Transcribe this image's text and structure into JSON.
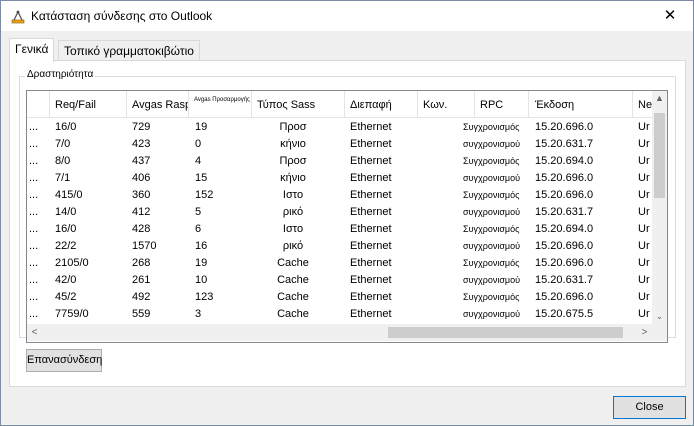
{
  "window": {
    "title": "Κατάσταση σύνδεσης στο Outlook",
    "close_glyph": "✕",
    "icon": "outlook-connection-icon"
  },
  "tabs": [
    {
      "label": "Γενικά"
    },
    {
      "label": "Τοπικό γραμματοκιβώτιο"
    }
  ],
  "group": {
    "label": "Δραστηριότητα"
  },
  "table": {
    "headers": [
      "",
      "Req/Fail",
      "Avgas Rasp",
      "Avgas Προσαρμογής",
      "Τύπος Sass",
      "Διεπαφή",
      "Κων.",
      "RPC",
      "Έκδοση",
      "Ne"
    ],
    "rows": [
      [
        "...",
        "16/0",
        "729",
        "19",
        "Προσ",
        "Ethernet",
        "",
        "Συγχρονισμός",
        "15.20.696.0",
        "Ur"
      ],
      [
        "...",
        "7/0",
        "423",
        "0",
        "κήνιο",
        "Ethernet",
        "",
        "συγχρονισμού",
        "15.20.631.7",
        "Ur"
      ],
      [
        "...",
        "8/0",
        "437",
        "4",
        "Προσ",
        "Ethernet",
        "",
        "Συγχρονισμός",
        "15.20.694.0",
        "Ur"
      ],
      [
        "...",
        "7/1",
        "406",
        "15",
        "κήνιο",
        "Ethernet",
        "",
        "συγχρονισμού",
        "15.20.696.0",
        "Ur"
      ],
      [
        "...",
        "415/0",
        "360",
        "152",
        "Ιστο",
        "Ethernet",
        "",
        "Συγχρονισμός",
        "15.20.696.0",
        "Ur"
      ],
      [
        "...",
        "14/0",
        "412",
        "5",
        "ρικό",
        "Ethernet",
        "",
        "συγχρονισμού",
        "15.20.631.7",
        "Ur"
      ],
      [
        "...",
        "16/0",
        "428",
        "6",
        "Ιστο",
        "Ethernet",
        "",
        "Συγχρονισμός",
        "15.20.694.0",
        "Ur"
      ],
      [
        "...",
        "22/2",
        "1570",
        "16",
        "ρικό",
        "Ethernet",
        "",
        "συγχρονισμού",
        "15.20.696.0",
        "Ur"
      ],
      [
        "...",
        "2105/0",
        "268",
        "19",
        "Cache",
        "Ethernet",
        "",
        "Συγχρονισμός",
        "15.20.696.0",
        "Ur"
      ],
      [
        "...",
        "42/0",
        "261",
        "10",
        "Cache",
        "Ethernet",
        "",
        "συγχρονισμού",
        "15.20.631.7",
        "Ur"
      ],
      [
        "...",
        "45/2",
        "492",
        "123",
        "Cache",
        "Ethernet",
        "",
        "Συγχρονισμός",
        "15.20.696.0",
        "Ur"
      ],
      [
        "...",
        "7759/0",
        "559",
        "3",
        "Cache",
        "Ethernet",
        "",
        "συγχρονισμού",
        "15.20.675.5",
        "Ur"
      ]
    ]
  },
  "scroll": {
    "up": "▲",
    "down": "⌄",
    "left": "<",
    "right": ">"
  },
  "buttons": {
    "reconnect": "Επανασύνδεση",
    "close": "Close"
  },
  "colors": {
    "accent": "#0078d7",
    "window_border": "#7a8ba6"
  }
}
